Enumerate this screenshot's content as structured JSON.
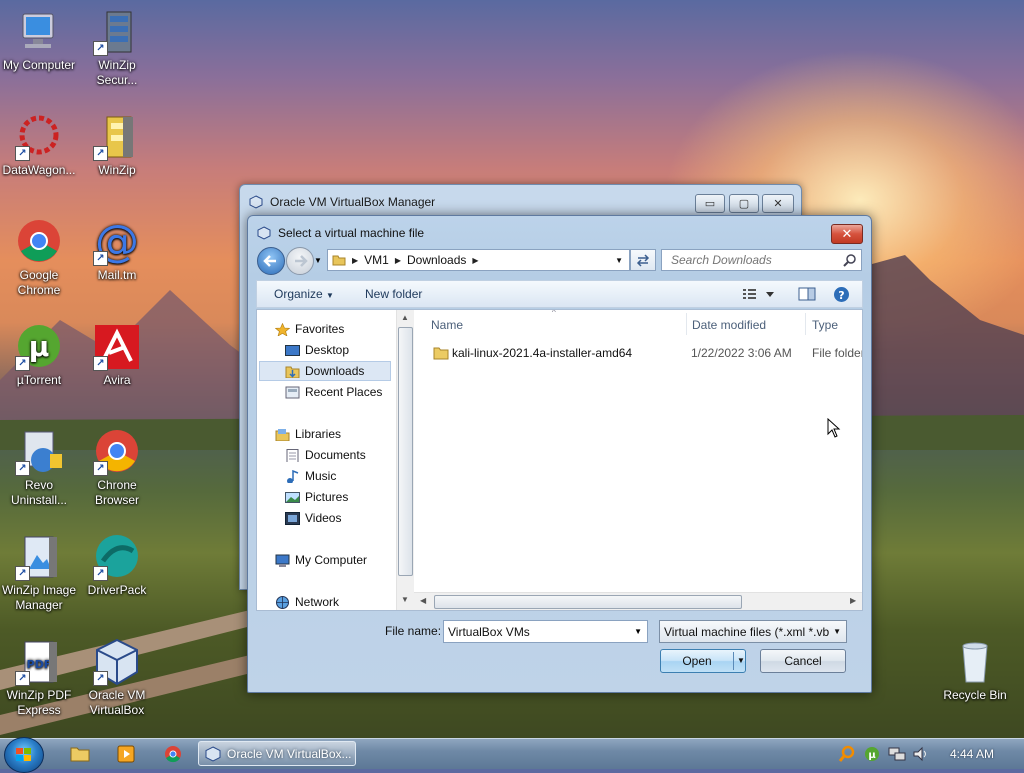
{
  "desktop": {
    "icons": [
      {
        "label": "My Computer"
      },
      {
        "label": "WinZip Secur..."
      },
      {
        "label": "DataWagon..."
      },
      {
        "label": "WinZip"
      },
      {
        "label": "Google Chrome"
      },
      {
        "label": "Mail.tm"
      },
      {
        "label": "µTorrent"
      },
      {
        "label": "Avira"
      },
      {
        "label": "Revo Uninstall..."
      },
      {
        "label": "Chrone Browser"
      },
      {
        "label": "WinZip Image Manager"
      },
      {
        "label": "DriverPack"
      },
      {
        "label": "WinZip PDF Express"
      },
      {
        "label": "Oracle VM VirtualBox"
      },
      {
        "label": "Recycle Bin"
      }
    ]
  },
  "background_window": {
    "title": "Oracle VM VirtualBox Manager"
  },
  "dialog": {
    "title": "Select a virtual machine file",
    "breadcrumb": [
      "VM1",
      "Downloads"
    ],
    "search_placeholder": "Search Downloads",
    "toolbar": {
      "organize_label": "Organize",
      "new_folder_label": "New folder"
    },
    "nav": {
      "favorites_label": "Favorites",
      "favorites": [
        {
          "label": "Desktop"
        },
        {
          "label": "Downloads"
        },
        {
          "label": "Recent Places"
        }
      ],
      "libraries_label": "Libraries",
      "libraries": [
        {
          "label": "Documents"
        },
        {
          "label": "Music"
        },
        {
          "label": "Pictures"
        },
        {
          "label": "Videos"
        }
      ],
      "computer_label": "My Computer",
      "network_label": "Network"
    },
    "columns": {
      "name": "Name",
      "date_modified": "Date modified",
      "type": "Type"
    },
    "files": [
      {
        "name": "kali-linux-2021.4a-installer-amd64",
        "date_modified": "1/22/2022 3:06 AM",
        "type": "File folder"
      }
    ],
    "file_name_label": "File name:",
    "file_name_value": "VirtualBox VMs",
    "file_type_filter": "Virtual machine files (*.xml *.vb",
    "open_label": "Open",
    "cancel_label": "Cancel"
  },
  "taskbar": {
    "active_window_label": "Oracle VM VirtualBox...",
    "clock": "4:44 AM"
  },
  "colors": {
    "dialog_chrome": "#bcd3ea",
    "close_button": "#c13a24",
    "taskbar": "#6f89a6",
    "selection": "#dce7f4"
  }
}
